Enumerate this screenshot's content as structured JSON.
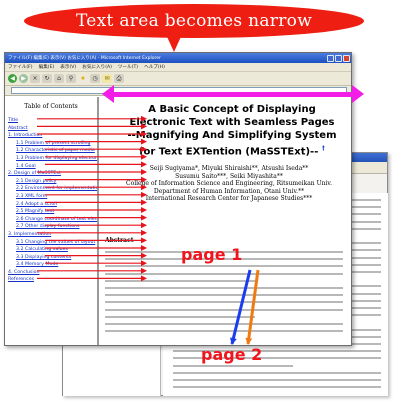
{
  "balloon": {
    "text": "Text area becomes narrow"
  },
  "browser": {
    "title": "ファイル(F)  編集(E)  表示(V)  お気に入り(A)  - Microsoft Internet Explorer",
    "menu": [
      "ファイル(F)",
      "編集(E)",
      "表示(V)",
      "お気に入り(A)",
      "ツール(T)",
      "ヘルプ(H)"
    ]
  },
  "toc": {
    "title": "Table of Contents",
    "items": [
      {
        "label": "Title",
        "level": 1
      },
      {
        "label": "Abstract",
        "level": 1
      },
      {
        "label": "1. Introduction",
        "level": 1
      },
      {
        "label": "1.1 Problem of present scrolling",
        "level": 2
      },
      {
        "label": "1.2 Characteristic of paper media",
        "level": 2
      },
      {
        "label": "1.3 Problem for displaying electronic text",
        "level": 2
      },
      {
        "label": "1.4 Goal",
        "level": 2
      },
      {
        "label": "2. Design of MaSSTExt",
        "level": 1
      },
      {
        "label": "2.1 Design policy",
        "level": 2
      },
      {
        "label": "2.2 Environment for implementation",
        "level": 2
      },
      {
        "label": "2.3 XML form",
        "level": 2
      },
      {
        "label": "2.4 Adopt a scroll",
        "level": 2
      },
      {
        "label": "2.5 Magnify text",
        "level": 2
      },
      {
        "label": "2.6 Change coordinate of text elements",
        "level": 2
      },
      {
        "label": "2.7 Other display functions",
        "level": 2
      },
      {
        "label": "3. Implementation",
        "level": 1
      },
      {
        "label": "3.1 Changing the values of layout",
        "level": 2
      },
      {
        "label": "3.2 Calculating values",
        "level": 2
      },
      {
        "label": "3.3 Displaying contents",
        "level": 2
      },
      {
        "label": "3.4 Memory Mode",
        "level": 2
      },
      {
        "label": "4. Conclusion",
        "level": 1
      },
      {
        "label": "References",
        "level": 1
      }
    ]
  },
  "paper": {
    "title_lines": [
      "A Basic Concept of Displaying",
      "Electronic Text with Seamless Pages",
      "--Magnifying And Simplifying System",
      "for Text EXTention (MaSSTExt)--"
    ],
    "title_mark": "†",
    "authors": [
      "Seiji Sugiyama*, Miyuki Shiraishi**, Atsushi Iseda**",
      "Susumu Saito***, Seiki Miyashita**",
      "College of Information Science and Engineering, Ritsumeikan Univ.",
      "Department of Human Information, Otani Univ.**",
      "International Research Center for Japanese Studies***"
    ],
    "abstract_label": "Abstract"
  },
  "page2_toc": [
    {
      "label": "3.1 Changing the values of layout",
      "level": 2
    },
    {
      "label": "3.2 Other display functions",
      "level": 2
    },
    {
      "label": "3. Implementation",
      "level": 1
    },
    {
      "label": "3.1 Changing the values of layout",
      "level": 2
    },
    {
      "label": "3.2 Calculating values",
      "level": 2
    },
    {
      "label": "3.3 Displaying contents",
      "level": 2
    },
    {
      "label": "3.4 Memory Mode",
      "level": 2
    },
    {
      "label": "4. Conclusion",
      "level": 1
    },
    {
      "label": "References",
      "level": 1
    }
  ],
  "labels": {
    "page1": "page 1",
    "page2": "page 2"
  },
  "colors": {
    "balloon": "#ef1e12",
    "arrow_pink": "#f21de6",
    "link": "#1530c8",
    "page_label": "#f2141c"
  }
}
